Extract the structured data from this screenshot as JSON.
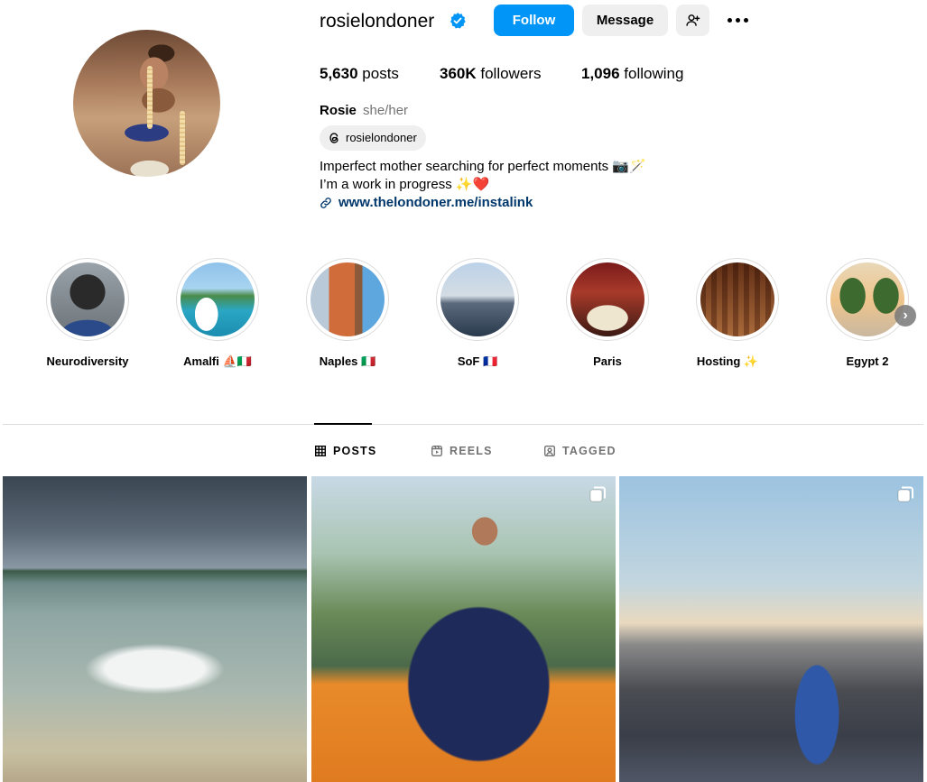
{
  "profile": {
    "username": "rosielondoner",
    "follow_label": "Follow",
    "message_label": "Message",
    "posts_count": "5,630",
    "posts_label": "posts",
    "followers_count": "360K",
    "followers_label": "followers",
    "following_count": "1,096",
    "following_label": "following",
    "full_name": "Rosie",
    "pronouns": "she/her",
    "threads_handle": "rosielondoner",
    "bio_line1": "Imperfect mother searching for perfect moments 📷🪄",
    "bio_line2": "I’m a work in progress ✨❤️",
    "link": "www.thelondoner.me/instalink"
  },
  "highlights": [
    {
      "label": "Neurodiversity"
    },
    {
      "label": "Amalfi ⛵🇮🇹"
    },
    {
      "label": "Naples 🇮🇹"
    },
    {
      "label": "SoF 🇫🇷"
    },
    {
      "label": "Paris"
    },
    {
      "label": "Hosting ✨"
    },
    {
      "label": "Egypt 2"
    }
  ],
  "tabs": {
    "posts": "POSTS",
    "reels": "REELS",
    "tagged": "TAGGED"
  },
  "colors": {
    "accent": "#0095f6",
    "button_gray": "#efefef",
    "secondary_text": "#737373",
    "link": "#00376b",
    "verified": "#0095f6"
  }
}
